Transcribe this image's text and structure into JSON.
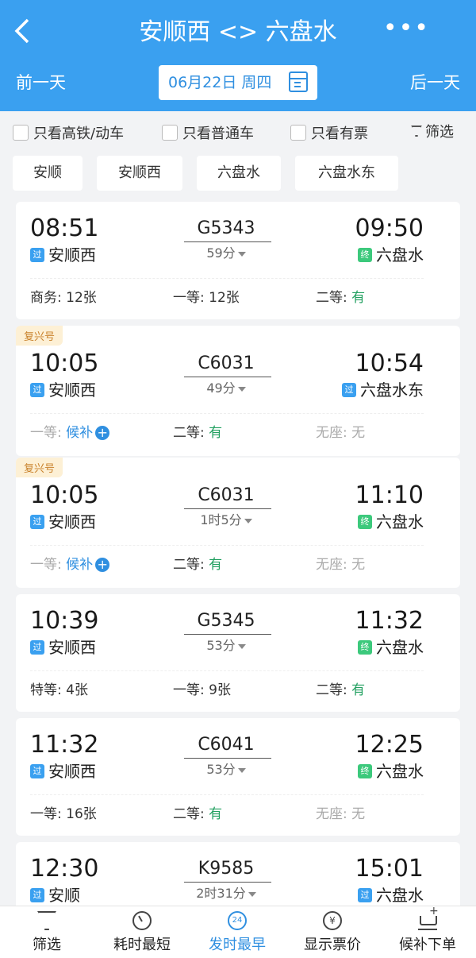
{
  "header": {
    "title": "安顺西 <> 六盘水",
    "back_icon": "back-arrow-icon",
    "more_icon": "more-icon",
    "prev_day": "前一天",
    "next_day": "后一天",
    "date_label": "06月22日  周四",
    "calendar_icon": "calendar-icon"
  },
  "filters": {
    "high_speed": "只看高铁/动车",
    "regular": "只看普通车",
    "has_tickets": "只看有票",
    "filter_label": "筛选"
  },
  "stations": [
    "安顺",
    "安顺西",
    "六盘水",
    "六盘水东"
  ],
  "badges": {
    "pass": "过",
    "end": "终"
  },
  "trains": [
    {
      "tag": "",
      "dep_time": "08:51",
      "dep_station": "安顺西",
      "dep_badge": "pass",
      "train_no": "G5343",
      "duration": "59分",
      "arr_time": "09:50",
      "arr_station": "六盘水",
      "arr_badge": "end",
      "seats": [
        {
          "label": "商务: ",
          "value": "12张",
          "state": "normal"
        },
        {
          "label": "一等: ",
          "value": "12张",
          "state": "normal"
        },
        {
          "label": "二等: ",
          "value": "有",
          "state": "avail"
        }
      ]
    },
    {
      "tag": "复兴号",
      "dep_time": "10:05",
      "dep_station": "安顺西",
      "dep_badge": "pass",
      "train_no": "C6031",
      "duration": "49分",
      "arr_time": "10:54",
      "arr_station": "六盘水东",
      "arr_badge": "pass",
      "seats": [
        {
          "label": "一等: ",
          "value": "候补",
          "state": "wait"
        },
        {
          "label": "二等: ",
          "value": "有",
          "state": "avail"
        },
        {
          "label": "无座: ",
          "value": "无",
          "state": "muted"
        }
      ]
    },
    {
      "tag": "复兴号",
      "dep_time": "10:05",
      "dep_station": "安顺西",
      "dep_badge": "pass",
      "train_no": "C6031",
      "duration": "1时5分",
      "arr_time": "11:10",
      "arr_station": "六盘水",
      "arr_badge": "end",
      "seats": [
        {
          "label": "一等: ",
          "value": "候补",
          "state": "wait"
        },
        {
          "label": "二等: ",
          "value": "有",
          "state": "avail"
        },
        {
          "label": "无座: ",
          "value": "无",
          "state": "muted"
        }
      ]
    },
    {
      "tag": "",
      "dep_time": "10:39",
      "dep_station": "安顺西",
      "dep_badge": "pass",
      "train_no": "G5345",
      "duration": "53分",
      "arr_time": "11:32",
      "arr_station": "六盘水",
      "arr_badge": "end",
      "seats": [
        {
          "label": "特等: ",
          "value": "4张",
          "state": "normal"
        },
        {
          "label": "一等: ",
          "value": "9张",
          "state": "normal"
        },
        {
          "label": "二等: ",
          "value": "有",
          "state": "avail"
        }
      ]
    },
    {
      "tag": "",
      "dep_time": "11:32",
      "dep_station": "安顺西",
      "dep_badge": "pass",
      "train_no": "C6041",
      "duration": "53分",
      "arr_time": "12:25",
      "arr_station": "六盘水",
      "arr_badge": "end",
      "seats": [
        {
          "label": "一等: ",
          "value": "16张",
          "state": "normal"
        },
        {
          "label": "二等: ",
          "value": "有",
          "state": "avail"
        },
        {
          "label": "无座: ",
          "value": "无",
          "state": "muted"
        }
      ]
    },
    {
      "tag": "",
      "dep_time": "12:30",
      "dep_station": "安顺",
      "dep_badge": "pass",
      "train_no": "K9585",
      "duration": "2时31分",
      "arr_time": "15:01",
      "arr_station": "六盘水",
      "arr_badge": "pass",
      "seats": []
    }
  ],
  "bottom_tabs": [
    {
      "label": "筛选",
      "icon": "filter-icon",
      "active": false
    },
    {
      "label": "耗时最短",
      "icon": "timer-icon",
      "active": false
    },
    {
      "label": "发时最早",
      "icon": "clock-24-icon",
      "icon_text": "24",
      "active": true
    },
    {
      "label": "显示票价",
      "icon": "yen-icon",
      "icon_text": "¥",
      "active": false
    },
    {
      "label": "候补下单",
      "icon": "cart-add-icon",
      "active": false
    }
  ],
  "colors": {
    "header_bg": "#3aa0f0",
    "accent": "#2f8fe0",
    "available": "#22a060",
    "pass_badge": "#3aa0f0",
    "end_badge": "#3cc97c",
    "tag_bg": "#fdf0d5",
    "tag_text": "#c9822c"
  }
}
